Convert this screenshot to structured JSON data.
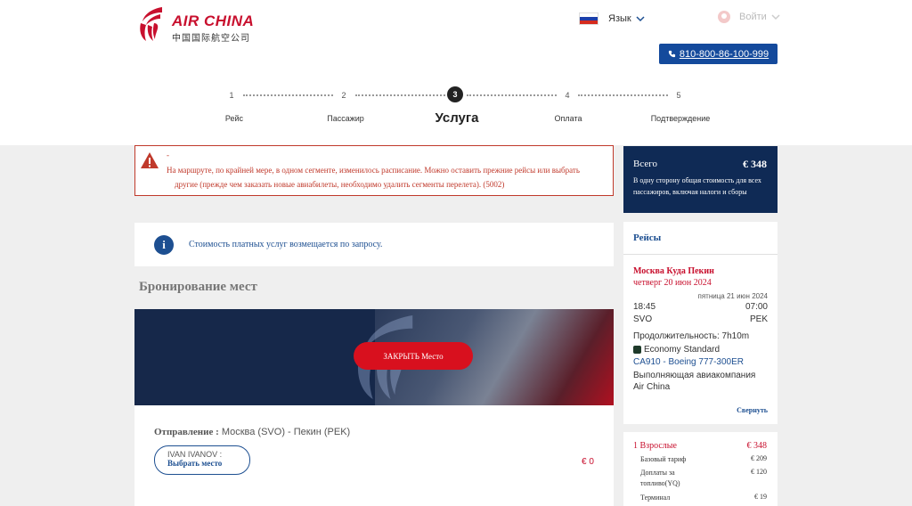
{
  "brand": {
    "name_en": "AIR CHINA",
    "name_cn": "中国国际航空公司",
    "primary_color": "#c8102e",
    "navy_color": "#0f2a55",
    "link_color": "#1d4f91"
  },
  "header": {
    "language_label": "Язык",
    "login_label": "Войти",
    "phone": "810-800-86-100-999"
  },
  "stepper": {
    "steps": [
      {
        "number": "1",
        "label": "Рейс"
      },
      {
        "number": "2",
        "label": "Пассажир"
      },
      {
        "number": "3",
        "label": "Услуга"
      },
      {
        "number": "4",
        "label": "Оплата"
      },
      {
        "number": "5",
        "label": "Подтверждение"
      }
    ],
    "active_index": 2
  },
  "alert": {
    "dash": "-",
    "line1": "На маршруте, по крайней мере, в одном сегменте, изменилось расписание. Можно оставить прежние рейсы или выбрать",
    "line2": "другие (прежде чем заказать новые авиабилеты, необходимо удалить сегменты перелета). (5002)"
  },
  "info": {
    "text": "Стоимость платных услуг возмещается по запросу."
  },
  "seat_booking": {
    "title": "Бронирование мест",
    "close_button": "ЗАКРЫТЬ Место",
    "departure_label": "Отправление :",
    "departure_route": "Москва (SVO) - Пекин (PEK)",
    "passenger_name": "IVAN IVANOV :",
    "choose_seat": "Выбрать место",
    "price": "€ 0"
  },
  "summary": {
    "total_label": "Всего",
    "total_amount": "€ 348",
    "total_desc": "В одну сторону общая стоимость для всех пассажиров, включая налоги и сборы"
  },
  "flights": {
    "title": "Рейсы",
    "route": "Москва Куда Пекин",
    "date": "четверг 20 июн 2024",
    "arrival_date": "пятница 21 июн 2024",
    "dep_time": "18:45",
    "arr_time": "07:00",
    "dep_code": "SVO",
    "arr_code": "PEK",
    "duration": "Продолжительность: 7h10m",
    "cabin": "Economy Standard",
    "flight": "CA910 - Boeing 777-300ER",
    "operated": "Выполняющая авиакомпания Air China",
    "collapse": "Свернуть"
  },
  "fare": {
    "adults_label": "1 Взрослые",
    "adults_amount": "€ 348",
    "rows": [
      {
        "label": "Базовый тариф",
        "value": "€ 209"
      },
      {
        "label": "Доплаты за топливо(YQ)",
        "value": "€ 120"
      },
      {
        "label": "Терминал",
        "value": "€ 19"
      }
    ]
  }
}
